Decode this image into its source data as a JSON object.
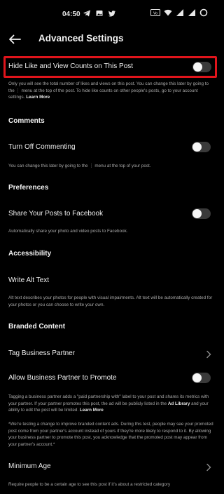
{
  "status_bar": {
    "time": "04:50"
  },
  "header": {
    "title": "Advanced Settings"
  },
  "hide_counts": {
    "label": "Hide Like and View Counts on This Post",
    "enabled": false,
    "desc_part1": "Only you will see the total number of likes and views on this post. You can change this later by going to the ⋮ menu at the top of the post. To hide like counts on other people's posts, go to your account settings. ",
    "learn_more": "Learn More"
  },
  "comments": {
    "section_title": "Comments",
    "label": "Turn Off Commenting",
    "enabled": false,
    "desc": "You can change this later by going to the ⋮ menu at the top of your post."
  },
  "preferences": {
    "section_title": "Preferences",
    "label": "Share Your Posts to Facebook",
    "enabled": false,
    "desc": "Automatically share your photo and video posts to Facebook."
  },
  "accessibility": {
    "section_title": "Accessibility",
    "label": "Write Alt Text",
    "desc": "Alt text describes your photos for people with visual impairments. Alt text will be automatically created for your photos or you can choose to write your own."
  },
  "branded": {
    "section_title": "Branded Content",
    "tag_label": "Tag Business Partner",
    "allow_label": "Allow Business Partner to Promote",
    "allow_enabled": false,
    "desc_part1": "Tagging a business partner adds a \"paid partnership with\" label to your post and shares its metrics with your partner. If your partner promotes this post, the ad will be publicly listed in the ",
    "ad_library": "Ad Library",
    "desc_part2": " and your ability to edit the post will be limited. ",
    "learn_more": "Learn More",
    "note": "*We're testing a change to improve branded content ads. During this test, people may see your promoted post come from your partner's account instead of yours if they're more likely to respond to it. By allowing your business partner to promote this post, you acknowledge that the promoted post may appear from your partner's account.*"
  },
  "minimum_age": {
    "label": "Minimum Age",
    "desc": "Require people to be a certain age to see this post if it's about a restricted category"
  },
  "colors": {
    "highlight": "#e0141b",
    "toggle_track": "#3a3a3a",
    "background": "#000000"
  }
}
